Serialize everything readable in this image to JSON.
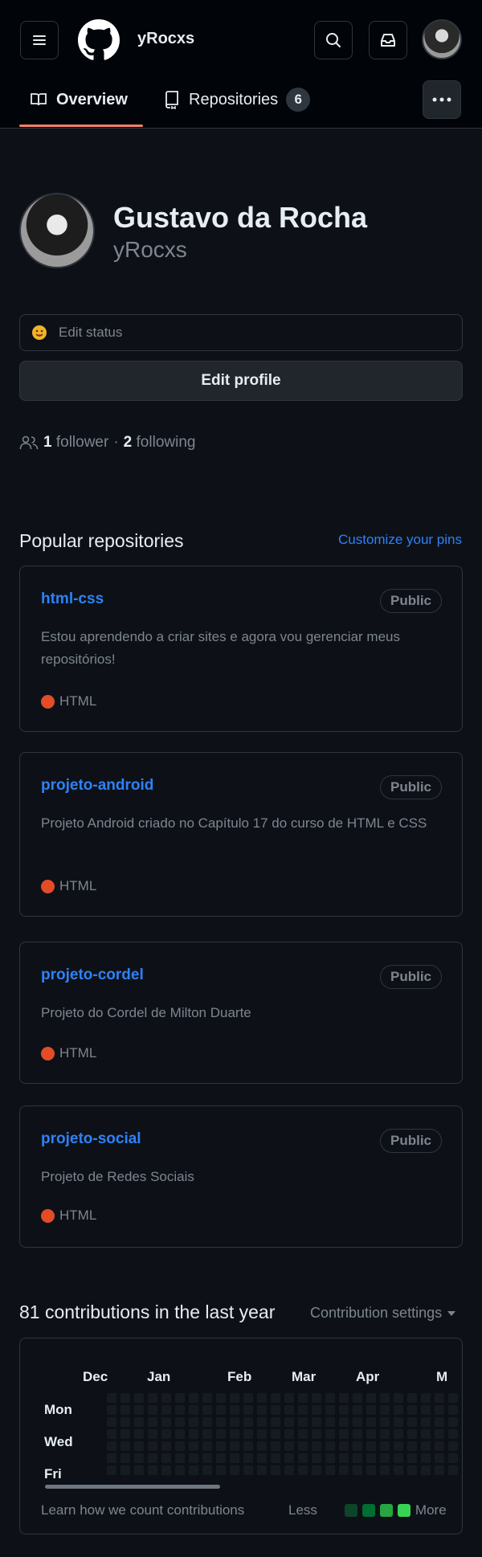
{
  "header": {
    "username": "yRocxs",
    "tabs": [
      {
        "label": "Overview"
      },
      {
        "label": "Repositories",
        "count": "6"
      }
    ]
  },
  "profile": {
    "name": "Gustavo da Rocha",
    "login": "yRocxs",
    "status_label": "Edit status",
    "edit_profile_label": "Edit profile",
    "followers_count": "1",
    "followers_label": "follower",
    "separator": "·",
    "following_count": "2",
    "following_label": "following"
  },
  "popular": {
    "title": "Popular repositories",
    "customize_label": "Customize your pins",
    "repos": [
      {
        "name": "html-css",
        "visibility": "Public",
        "description": "Estou aprendendo a criar sites e agora vou gerenciar meus repositórios!",
        "language": "HTML"
      },
      {
        "name": "projeto-android",
        "visibility": "Public",
        "description": "Projeto Android criado no Capítulo 17 do curso de HTML e CSS",
        "language": "HTML"
      },
      {
        "name": "projeto-cordel",
        "visibility": "Public",
        "description": "Projeto do Cordel de Milton Duarte",
        "language": "HTML"
      },
      {
        "name": "projeto-social",
        "visibility": "Public",
        "description": "Projeto de Redes Sociais",
        "language": "HTML"
      }
    ]
  },
  "contributions": {
    "title": "81 contributions in the last year",
    "settings_label": "Contribution settings",
    "months": [
      "Dec",
      "Jan",
      "Feb",
      "Mar",
      "Apr",
      "M"
    ],
    "days": [
      "Mon",
      "Wed",
      "Fri"
    ],
    "learn_label": "Learn how we count contributions",
    "less_label": "Less",
    "more_label": "More",
    "legend_colors": [
      "#0e4429",
      "#006d32",
      "#26a641",
      "#39d353"
    ]
  },
  "colors": {
    "background": "#0d1117",
    "header_bg": "#010409",
    "link": "#2f81f7",
    "tab_underline": "#f78166",
    "html_language": "#e34c26"
  }
}
